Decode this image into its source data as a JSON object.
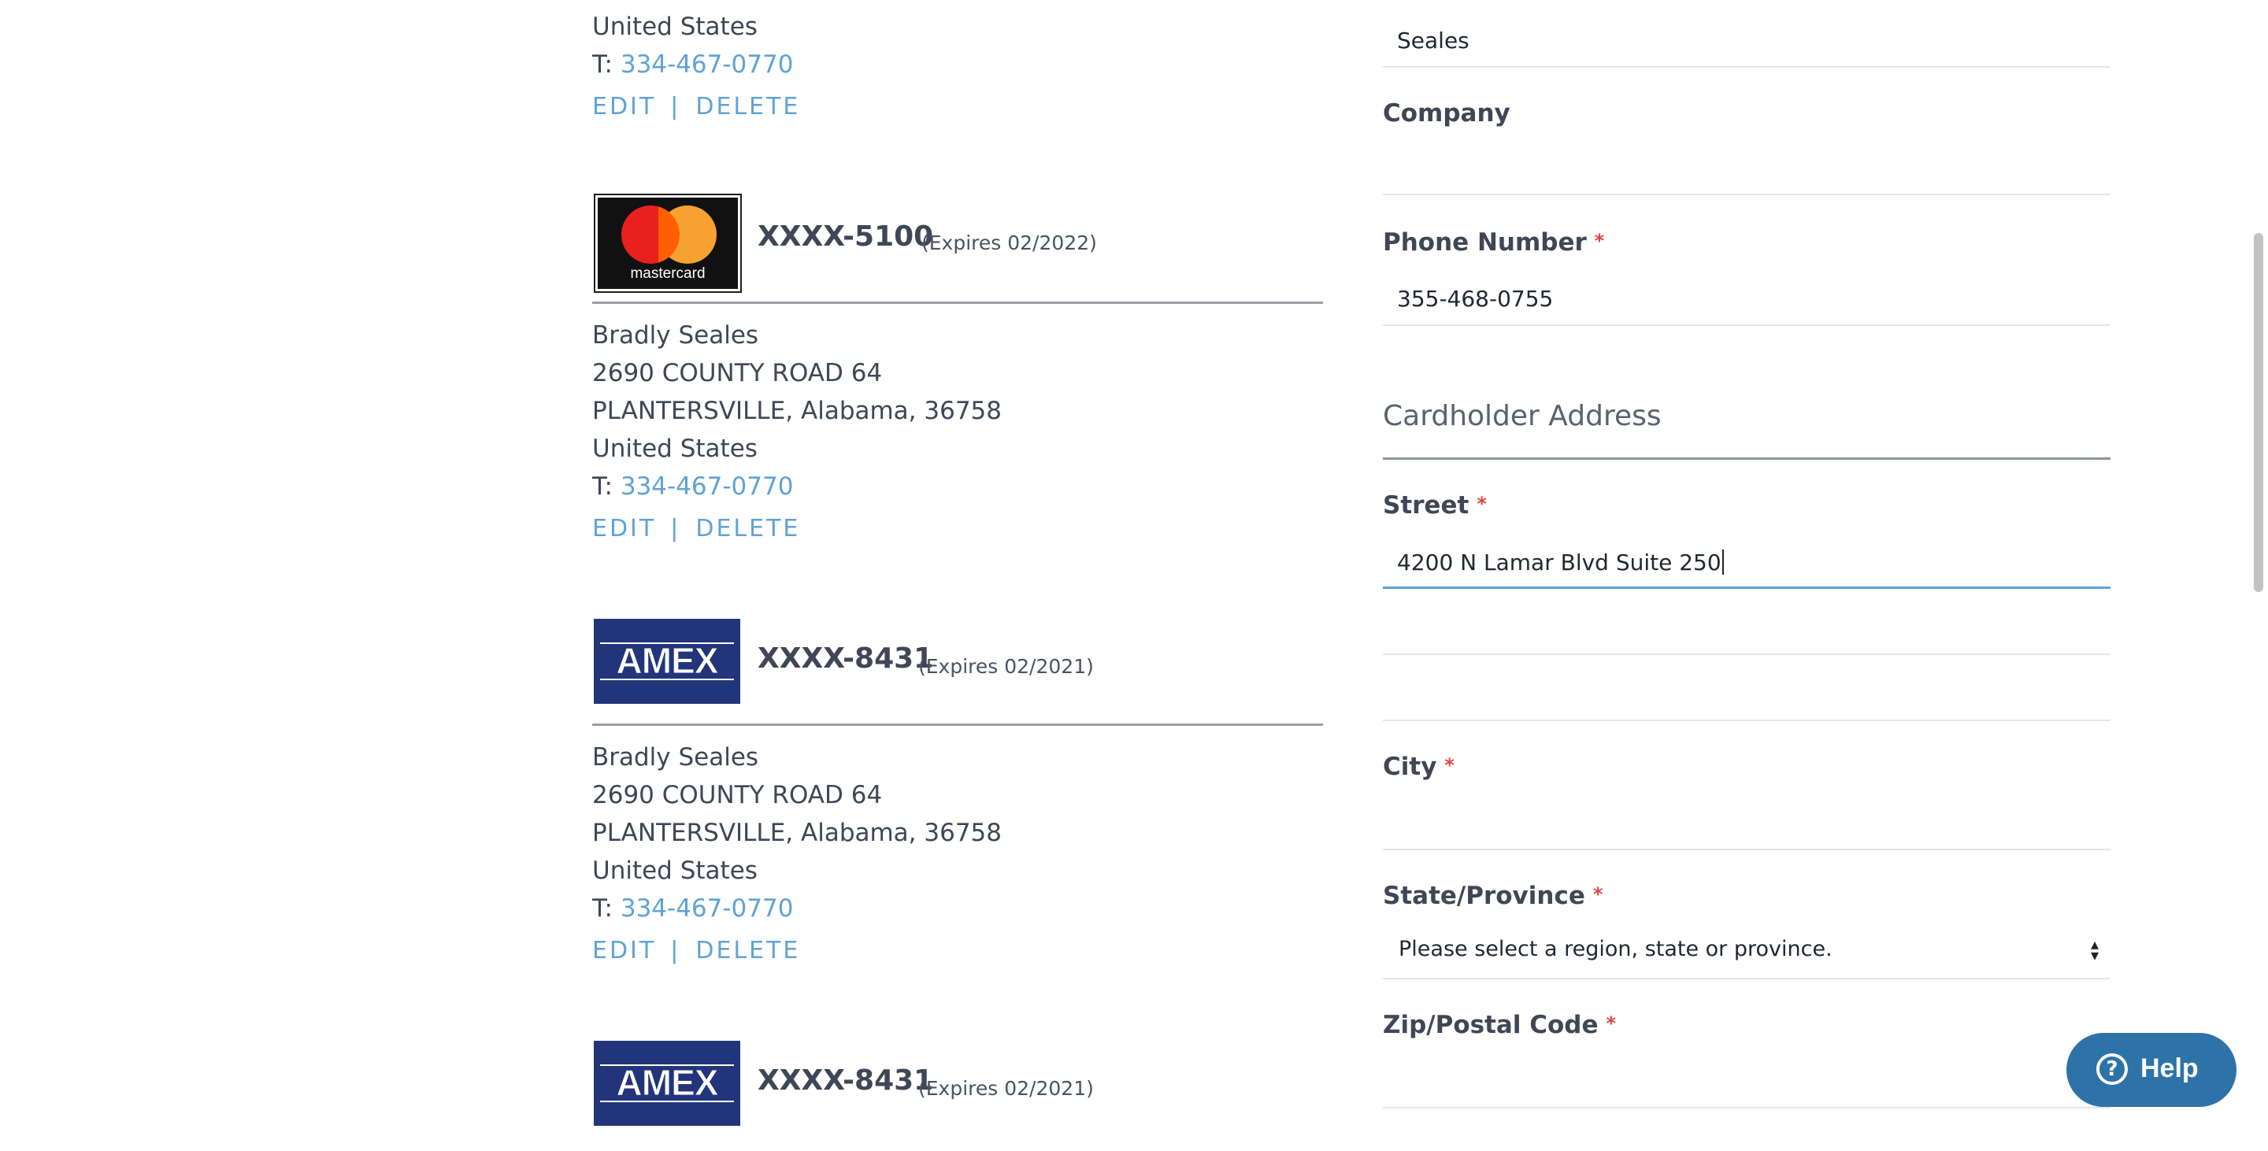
{
  "saved_cards": {
    "partial_top": {
      "country": "United States",
      "tel_prefix": "T: ",
      "tel": "334-467-0770",
      "edit_label": "EDIT",
      "separator": "|",
      "delete_label": "DELETE"
    },
    "cards": [
      {
        "brand": "mastercard",
        "logo_text": "mastercard",
        "number": "XXXX-5100",
        "expires": "(Expires 02/2022)",
        "name": "Bradly Seales",
        "street": "2690 COUNTY ROAD 64",
        "city_line": "PLANTERSVILLE, Alabama, 36758",
        "country": "United States",
        "tel_prefix": "T: ",
        "tel": "334-467-0770",
        "edit_label": "EDIT",
        "separator": "|",
        "delete_label": "DELETE"
      },
      {
        "brand": "amex",
        "logo_text": "AMEX",
        "number": "XXXX-8431",
        "expires": "(Expires 02/2021)",
        "name": "Bradly Seales",
        "street": "2690 COUNTY ROAD 64",
        "city_line": "PLANTERSVILLE, Alabama, 36758",
        "country": "United States",
        "tel_prefix": "T: ",
        "tel": "334-467-0770",
        "edit_label": "EDIT",
        "separator": "|",
        "delete_label": "DELETE"
      },
      {
        "brand": "amex",
        "logo_text": "AMEX",
        "number": "XXXX-8431",
        "expires": "(Expires 02/2021)"
      }
    ]
  },
  "form": {
    "last_name_value": "Seales",
    "company_label": "Company",
    "company_value": "",
    "phone_label": "Phone Number",
    "phone_value": "355-468-0755",
    "address_section_title": "Cardholder Address",
    "street_label": "Street",
    "street_value": "4200 N Lamar Blvd Suite 250",
    "street_line2_value": "",
    "street_line3_value": "",
    "city_label": "City",
    "city_value": "",
    "state_label": "State/Province",
    "state_selected": "Please select a region, state or province.",
    "zip_label": "Zip/Postal Code",
    "zip_value": "",
    "required_mark": "*"
  },
  "help": {
    "label": "Help",
    "icon": "question-circle-icon"
  },
  "colors": {
    "link": "#5fa3d6",
    "required": "#e0453f",
    "help_bg": "#2d73a8",
    "amex_bg": "#22357b",
    "text": "#3f4756"
  }
}
